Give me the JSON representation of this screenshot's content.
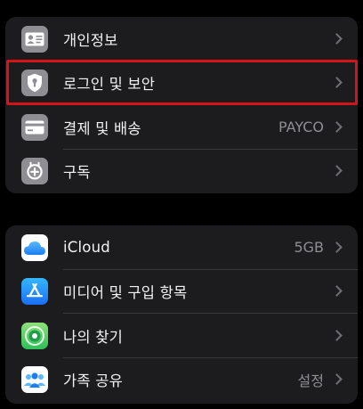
{
  "groups": [
    {
      "items": [
        {
          "label": "개인정보",
          "value": "",
          "icon": "contact-card-icon"
        },
        {
          "label": "로그인 및 보안",
          "value": "",
          "icon": "shield-keyhole-icon"
        },
        {
          "label": "결제 및 배송",
          "value": "PAYCO",
          "icon": "credit-card-icon"
        },
        {
          "label": "구독",
          "value": "",
          "icon": "subscription-icon"
        }
      ]
    },
    {
      "items": [
        {
          "label": "iCloud",
          "value": "5GB",
          "icon": "icloud-icon"
        },
        {
          "label": "미디어 및 구입 항목",
          "value": "",
          "icon": "app-store-icon"
        },
        {
          "label": "나의 찾기",
          "value": "",
          "icon": "find-my-icon"
        },
        {
          "label": "가족 공유",
          "value": "설정",
          "icon": "family-sharing-icon"
        }
      ]
    }
  ],
  "colors": {
    "background": "#000000",
    "group": "#1c1c1e",
    "highlight": "#d4141b",
    "gray_icon": "#8e8e93",
    "blue": "#1a8cff"
  }
}
